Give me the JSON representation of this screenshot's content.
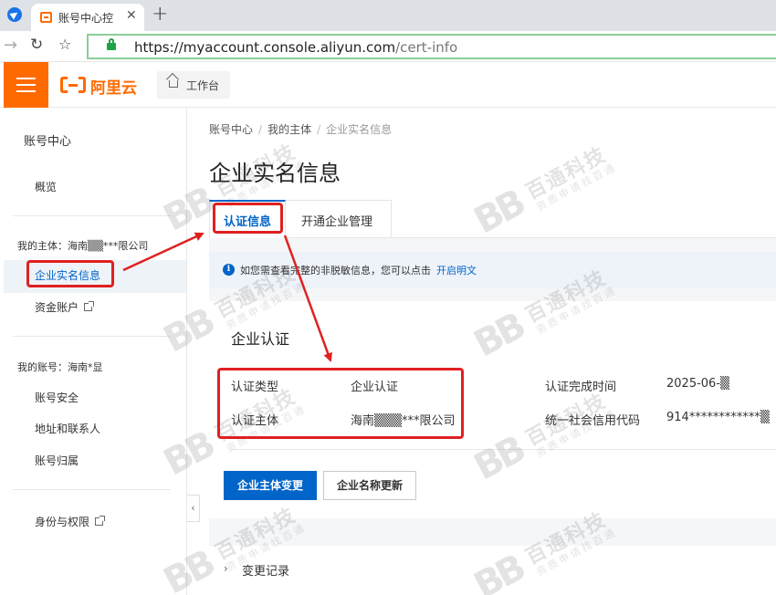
{
  "browser": {
    "tab_title": "账号中心控",
    "tab_close": "✕",
    "new_tab": "+",
    "url_main": "https://myaccount.console.aliyun.com",
    "url_path": "/cert-info"
  },
  "topbar": {
    "logo_text": "阿里云",
    "workbench_label": "工作台"
  },
  "sidebar": {
    "title": "账号中心",
    "overview": "概览",
    "subject_label": "我的主体：海南▒▒***限公司",
    "cert_info": "企业实名信息",
    "fund_account": "资金账户",
    "account_label": "我的账号：海南*显",
    "account_security": "账号安全",
    "address_contacts": "地址和联系人",
    "account_ownership": "账号归属",
    "identity_permissions": "身份与权限"
  },
  "breadcrumb": {
    "item1": "账号中心",
    "item2": "我的主体",
    "item3": "企业实名信息",
    "sep": "/"
  },
  "page": {
    "title": "企业实名信息"
  },
  "tabs": {
    "cert_info": "认证信息",
    "enterprise_mgmt": "开通企业管理"
  },
  "notice": {
    "icon": "i",
    "text": "如您需查看完整的非脱敏信息，您可以点击",
    "link": "开启明文"
  },
  "card": {
    "title": "企业认证",
    "rows": [
      {
        "label": "认证类型",
        "value": "企业认证"
      },
      {
        "label": "认证主体",
        "value": "海南▒▒▒***限公司"
      },
      {
        "label": "认证完成时间",
        "value": "2025-06-▒"
      },
      {
        "label": "统一社会信用代码",
        "value": "914************▒"
      }
    ],
    "btn_change": "企业主体变更",
    "btn_rename": "企业名称更新"
  },
  "history": {
    "chevron": "›",
    "label": "变更记录"
  },
  "watermark": {
    "mark": "BB",
    "name": "百通科技",
    "sub": "资质申请找百通"
  },
  "colors": {
    "brand_orange": "#ff6a00",
    "primary_blue": "#0064c8",
    "annotation_red": "#e02020"
  }
}
